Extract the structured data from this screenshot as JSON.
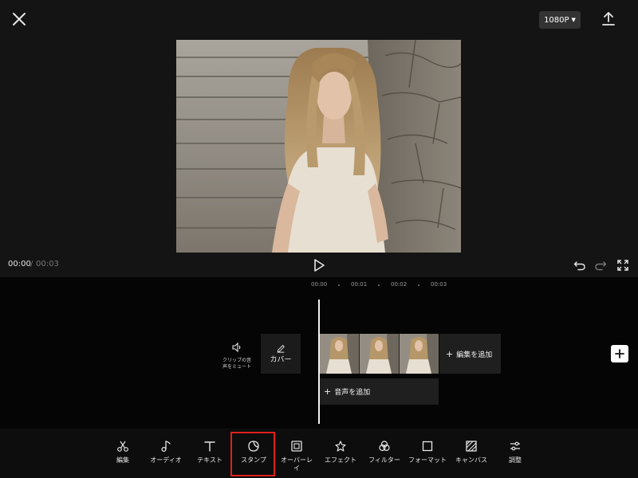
{
  "header": {
    "resolution": "1080P",
    "close_icon": "close-icon",
    "export_icon": "export-icon"
  },
  "preview": {
    "image_description": "portrait"
  },
  "playback": {
    "current_time": "00:00",
    "separator": "/",
    "total_time": "00:03"
  },
  "timeline": {
    "ticks": [
      "00:00",
      "00:01",
      "00:02",
      "00:03"
    ],
    "mute_label_line1": "クリップの音",
    "mute_label_line2": "声をミュート",
    "cover_label": "カバー",
    "add_edit_label": "編集を追加",
    "add_audio_label": "音声を追加"
  },
  "toolbar": {
    "items": [
      {
        "label": "編集",
        "icon": "scissors-icon"
      },
      {
        "label": "オーディオ",
        "icon": "music-note-icon"
      },
      {
        "label": "テキスト",
        "icon": "text-icon"
      },
      {
        "label": "スタンプ",
        "icon": "sticker-icon"
      },
      {
        "label": "オーバーレイ",
        "icon": "overlay-icon"
      },
      {
        "label": "エフェクト",
        "icon": "effect-icon"
      },
      {
        "label": "フィルター",
        "icon": "filter-icon"
      },
      {
        "label": "フォーマット",
        "icon": "format-icon"
      },
      {
        "label": "キャンバス",
        "icon": "canvas-icon"
      },
      {
        "label": "調整",
        "icon": "adjust-icon"
      }
    ],
    "highlighted": "スタンプ"
  },
  "colors": {
    "background": "#141414",
    "timeline_bg": "#050505",
    "highlight": "#e0201b"
  }
}
